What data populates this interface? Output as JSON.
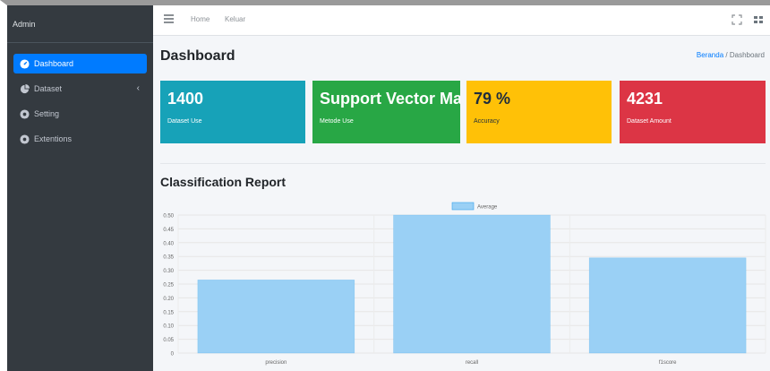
{
  "sidebar": {
    "brand": "Admin",
    "items": [
      {
        "label": "Dashboard",
        "icon": "tachometer-icon",
        "active": true
      },
      {
        "label": "Dataset",
        "icon": "chart-pie-icon",
        "active": false,
        "chevron": "‹"
      },
      {
        "label": "Setting",
        "icon": "cogs-icon",
        "active": false
      },
      {
        "label": "Extentions",
        "icon": "cogs-icon",
        "active": false
      }
    ]
  },
  "navbar": {
    "links": [
      "Home",
      "Keluar"
    ],
    "icons": [
      "hamburger-icon",
      "expand-icon",
      "grid-icon"
    ]
  },
  "page": {
    "title": "Dashboard",
    "breadcrumb": [
      "Beranda",
      "Dashboard"
    ],
    "breadcrumb_sep": "/"
  },
  "info_boxes": [
    {
      "value": "1400",
      "label": "Dataset Use",
      "color": "#17a2b8"
    },
    {
      "value": "Support Vector Machine",
      "label": "Metode Use",
      "color": "#28a745"
    },
    {
      "value": "79 %",
      "label": "Accuracy",
      "color": "#ffc107"
    },
    {
      "value": "4231",
      "label": "Dataset Amount",
      "color": "#dc3545"
    }
  ],
  "report": {
    "title": "Classification Report"
  },
  "chart_data": {
    "type": "bar",
    "categories": [
      "precision",
      "recall",
      "f1score"
    ],
    "series": [
      {
        "name": "Average",
        "values": [
          0.265,
          0.5,
          0.345
        ],
        "color": "#9ad0f5",
        "border": "#36a2eb"
      }
    ],
    "ylim": [
      0,
      0.5
    ],
    "yticks": [
      "0",
      "0.05",
      "0.10",
      "0.15",
      "0.20",
      "0.25",
      "0.30",
      "0.35",
      "0.40",
      "0.45",
      "0.50"
    ],
    "grid": true,
    "legend": "top-center"
  }
}
